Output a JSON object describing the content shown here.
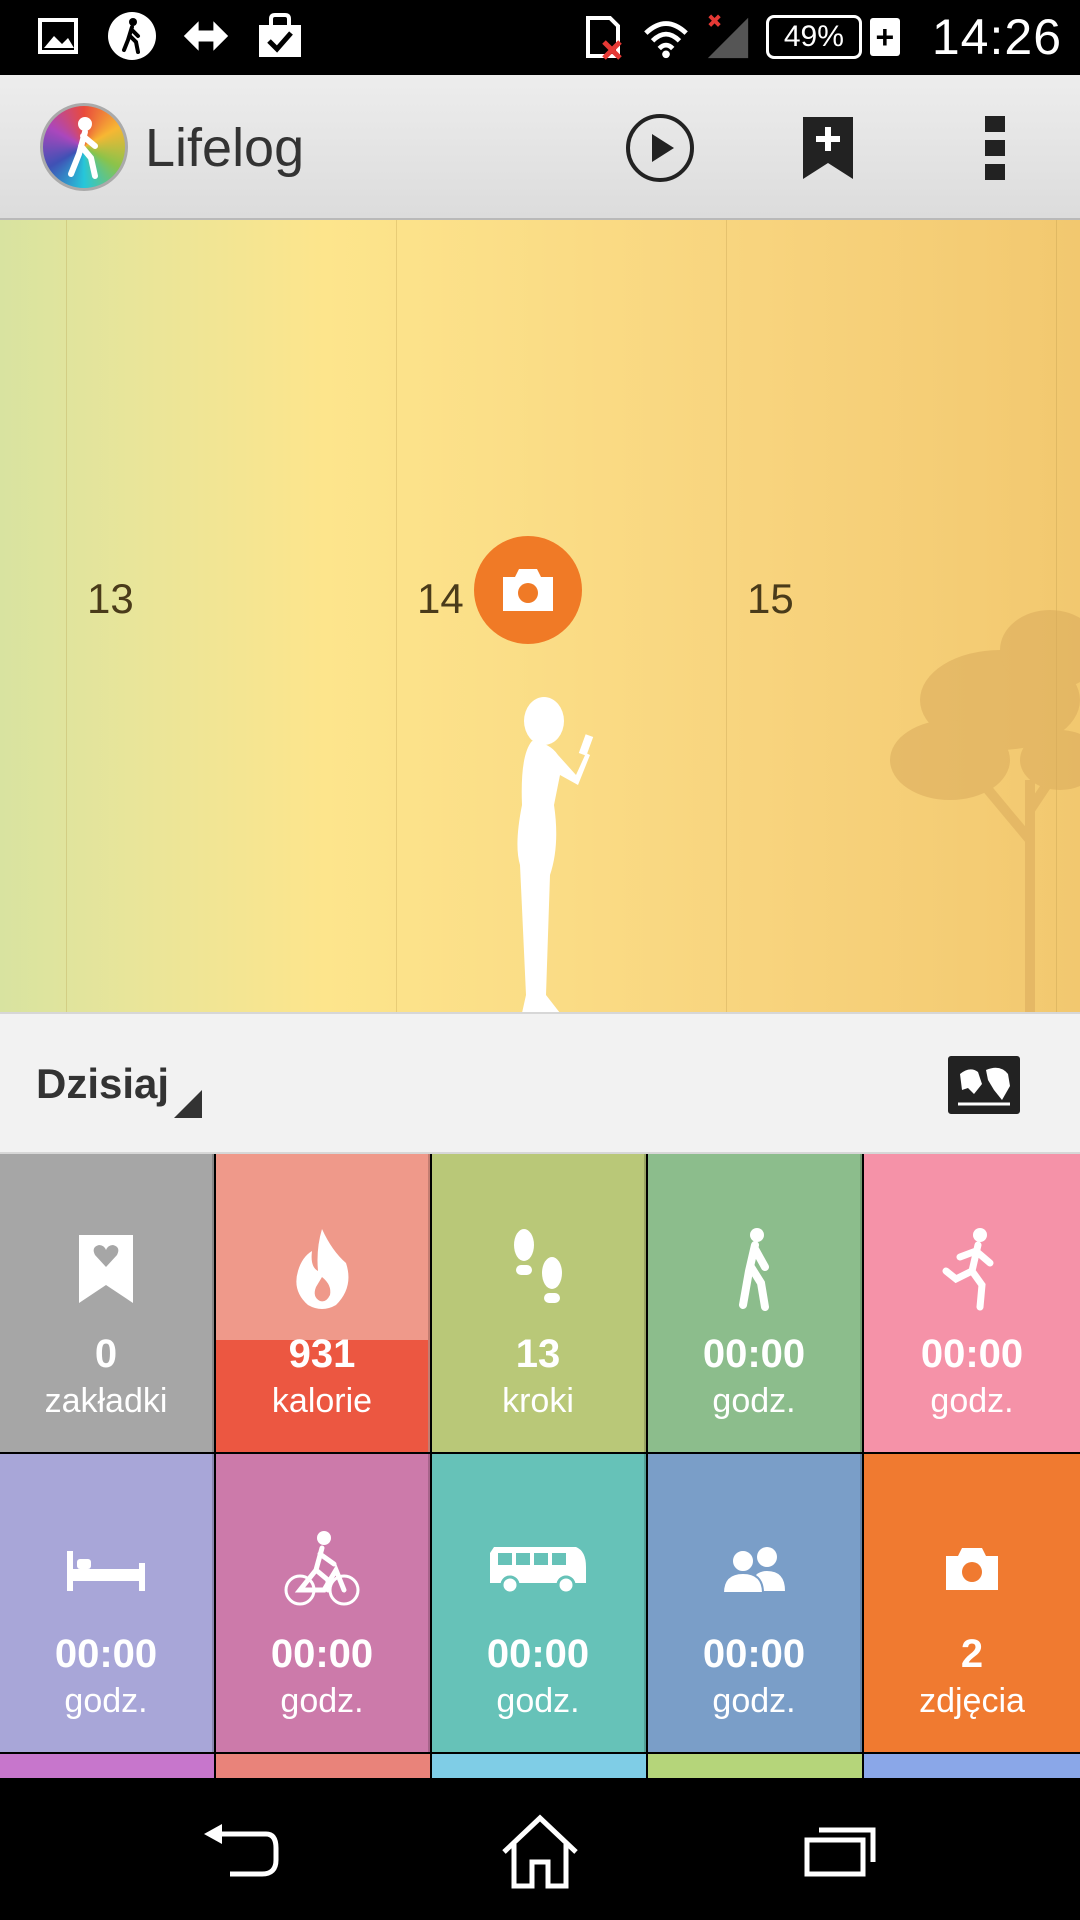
{
  "status_bar": {
    "battery": "49%",
    "time": "14:26",
    "left_icons": [
      "gallery-icon",
      "walking-icon",
      "arrows-icon",
      "shopping-bag-icon"
    ],
    "right_icons": [
      "sd-card-error-icon",
      "wifi-icon",
      "signal-icon",
      "battery-icon",
      "charging-icon"
    ]
  },
  "action_bar": {
    "title": "Lifelog",
    "icons": [
      "lifelog-logo-icon",
      "play-icon",
      "add-bookmark-icon",
      "overflow-menu-icon"
    ]
  },
  "timeline": {
    "days": [
      "13",
      "14",
      "15"
    ],
    "event_icon": "camera-icon"
  },
  "date_header": {
    "label": "Dzisiaj",
    "map_icon": "world-map-icon"
  },
  "tiles": [
    {
      "value": "0",
      "unit": "zakładki",
      "icon": "bookmark-heart-icon",
      "color": "#a6a6a6"
    },
    {
      "value": "931",
      "unit": "kalorie",
      "icon": "flame-icon",
      "color": "#ef998a"
    },
    {
      "value": "13",
      "unit": "kroki",
      "icon": "footsteps-icon",
      "color": "#b9c878"
    },
    {
      "value": "00:00",
      "unit": "godz.",
      "icon": "walking-icon",
      "color": "#8cbd8c"
    },
    {
      "value": "00:00",
      "unit": "godz.",
      "icon": "running-icon",
      "color": "#f592a8"
    },
    {
      "value": "00:00",
      "unit": "godz.",
      "icon": "bed-icon",
      "color": "#a8a6d8"
    },
    {
      "value": "00:00",
      "unit": "godz.",
      "icon": "bicycle-icon",
      "color": "#cc7aaa"
    },
    {
      "value": "00:00",
      "unit": "godz.",
      "icon": "bus-icon",
      "color": "#66c2b8"
    },
    {
      "value": "00:00",
      "unit": "godz.",
      "icon": "people-icon",
      "color": "#7a9ec8"
    },
    {
      "value": "2",
      "unit": "zdjęcia",
      "icon": "camera-icon",
      "color": "#f07a30"
    }
  ],
  "peek_colors": [
    "#c776cc",
    "#e9837a",
    "#7fcde6",
    "#b5d57a",
    "#8aa7e8"
  ],
  "nav_bar": {
    "icons": [
      "back-icon",
      "home-icon",
      "recent-apps-icon"
    ]
  }
}
